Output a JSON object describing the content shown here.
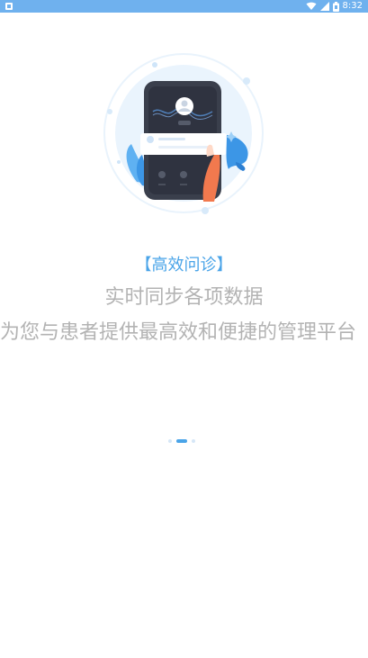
{
  "status_bar": {
    "time": "8:32",
    "color": "#6fb1ee",
    "icons": [
      "notification-icon",
      "wifi-icon",
      "signal-icon",
      "battery-icon"
    ]
  },
  "onboarding": {
    "tag": "【高效问诊】",
    "subtitle": "实时同步各项数据",
    "description": "为您与患者提供最高效和便捷的管理平台",
    "illustration": "phone-video-consultation-illustration",
    "pager": {
      "total": 3,
      "current": 2
    },
    "accent_color": "#4aa4e8",
    "text_color": "#b3b3b3"
  }
}
